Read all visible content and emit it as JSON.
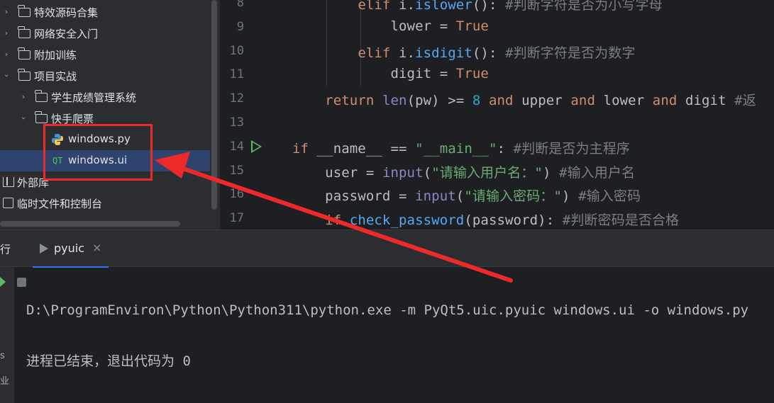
{
  "project_tree": {
    "items": [
      {
        "label": "特效源码合集",
        "type": "folder",
        "expanded": false
      },
      {
        "label": "网络安全入门",
        "type": "folder",
        "expanded": false
      },
      {
        "label": "附加训练",
        "type": "folder",
        "expanded": false
      },
      {
        "label": "项目实战",
        "type": "folder",
        "expanded": true
      },
      {
        "label": "学生成绩管理系统",
        "type": "folder",
        "expanded": false
      },
      {
        "label": "快手爬票",
        "type": "folder",
        "expanded": true
      },
      {
        "label": "windows.py",
        "type": "python-file"
      },
      {
        "label": "windows.ui",
        "type": "qt-ui-file",
        "selected": true
      },
      {
        "label": "外部库",
        "type": "external-libraries"
      },
      {
        "label": "临时文件和控制台",
        "type": "scratches"
      }
    ],
    "qt_icon_text": "QT"
  },
  "editor": {
    "lines": [
      {
        "num": "8",
        "code": "        elif i.islower(): #判断字符是否为小写字母"
      },
      {
        "num": "9",
        "code": "            lower = True"
      },
      {
        "num": "10",
        "code": "        elif i.isdigit(): #判断字符是否为数字"
      },
      {
        "num": "11",
        "code": "            digit = True"
      },
      {
        "num": "12",
        "code": "    return len(pw) >= 8 and upper and lower and digit #返"
      },
      {
        "num": "13",
        "code": ""
      },
      {
        "num": "14",
        "code": "if __name__ == \"__main__\": #判断是否为主程序"
      },
      {
        "num": "15",
        "code": "    user = input(\"请输入用户名：\") #输入用户名"
      },
      {
        "num": "16",
        "code": "    password = input(\"请输入密码：\") #输入密码"
      },
      {
        "num": "17",
        "code": "    if check_password(password): #判断密码是否合格"
      }
    ]
  },
  "run_window": {
    "title": "运行",
    "tab_label": "pyuic",
    "tab_close": "×",
    "side_glyphs": [
      "s",
      "业"
    ],
    "output": [
      "D:\\ProgramEnviron\\Python\\Python311\\python.exe -m PyQt5.uic.pyuic windows.ui -o windows.py",
      "",
      "进程已结束，退出代码为 0"
    ]
  },
  "colors": {
    "annotation": "#ec2a2a",
    "selection": "#2e436e",
    "keyword": "#cf8e6d",
    "string": "#6aab73",
    "comment": "#7a7e85"
  }
}
